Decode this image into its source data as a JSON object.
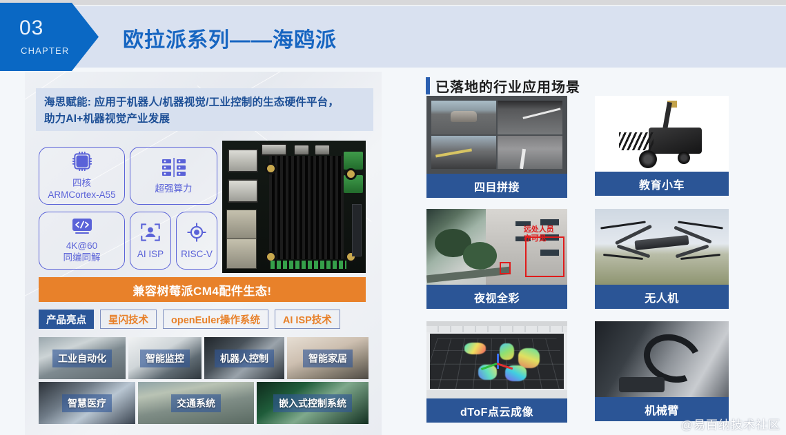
{
  "header": {
    "chapter_number": "03",
    "chapter_word": "CHAPTER",
    "title": "欧拉派系列——海鸥派"
  },
  "left_panel": {
    "intro_line1": "海思赋能: 应用于机器人/机器视觉/工业控制的生态硬件平台，",
    "intro_line2": "助力AI+机器视觉产业发展",
    "features": [
      {
        "icon": "cpu-chip-icon",
        "label_line1": "四核",
        "label_line2": "ARMCortex-A55"
      },
      {
        "icon": "server-rack-icon",
        "label_line1": "超强算力",
        "label_line2": ""
      },
      {
        "icon": "code-brackets-icon",
        "label_line1": "4K@60",
        "label_line2": "同编同解"
      },
      {
        "icon": "face-detect-icon",
        "label_line1": "AI ISP",
        "label_line2": ""
      },
      {
        "icon": "target-crosshair-icon",
        "label_line1": "RISC-V",
        "label_line2": ""
      }
    ],
    "board_photo_alt": "single-board-computer-photo",
    "cm4_banner": "兼容树莓派CM4配件生态!",
    "tags": [
      {
        "label": "产品亮点",
        "style": "filled"
      },
      {
        "label": "星闪技术",
        "style": "outline"
      },
      {
        "label": "openEuler操作系统",
        "style": "outline"
      },
      {
        "label": "AI ISP技术",
        "style": "outline"
      }
    ],
    "scene_row1": [
      {
        "caption": "工业自动化",
        "width": 126
      },
      {
        "caption": "智能监控",
        "width": 106
      },
      {
        "caption": "机器人控制",
        "width": 116
      },
      {
        "caption": "智能家居",
        "width": 118
      }
    ],
    "scene_row2": [
      {
        "caption": "智慧医疗",
        "width": 140
      },
      {
        "caption": "交通系统",
        "width": 168
      },
      {
        "caption": "嵌入式控制系统",
        "width": 162
      }
    ]
  },
  "right_panel": {
    "title": "已落地的行业应用场景",
    "cards": [
      {
        "caption": "四目拼接",
        "art": "quadview"
      },
      {
        "caption": "教育小车",
        "art": "robotcar"
      },
      {
        "caption": "夜视全彩",
        "art": "nightview",
        "annotation": "远处人员亦可见"
      },
      {
        "caption": "无人机",
        "art": "drone"
      },
      {
        "caption": "dToF点云成像",
        "art": "pointcloud"
      },
      {
        "caption": "机械臂",
        "art": "robotarm"
      }
    ]
  },
  "watermark": "@易百纳技术社区",
  "colors": {
    "brand_blue": "#0a68c4",
    "header_band": "#d9e1f0",
    "title_blue": "#1665c1",
    "accent_orange": "#e8812a",
    "caption_blue": "#2b5596",
    "feature_purple": "#5a62d8",
    "annotation_red": "#e01b1b"
  }
}
